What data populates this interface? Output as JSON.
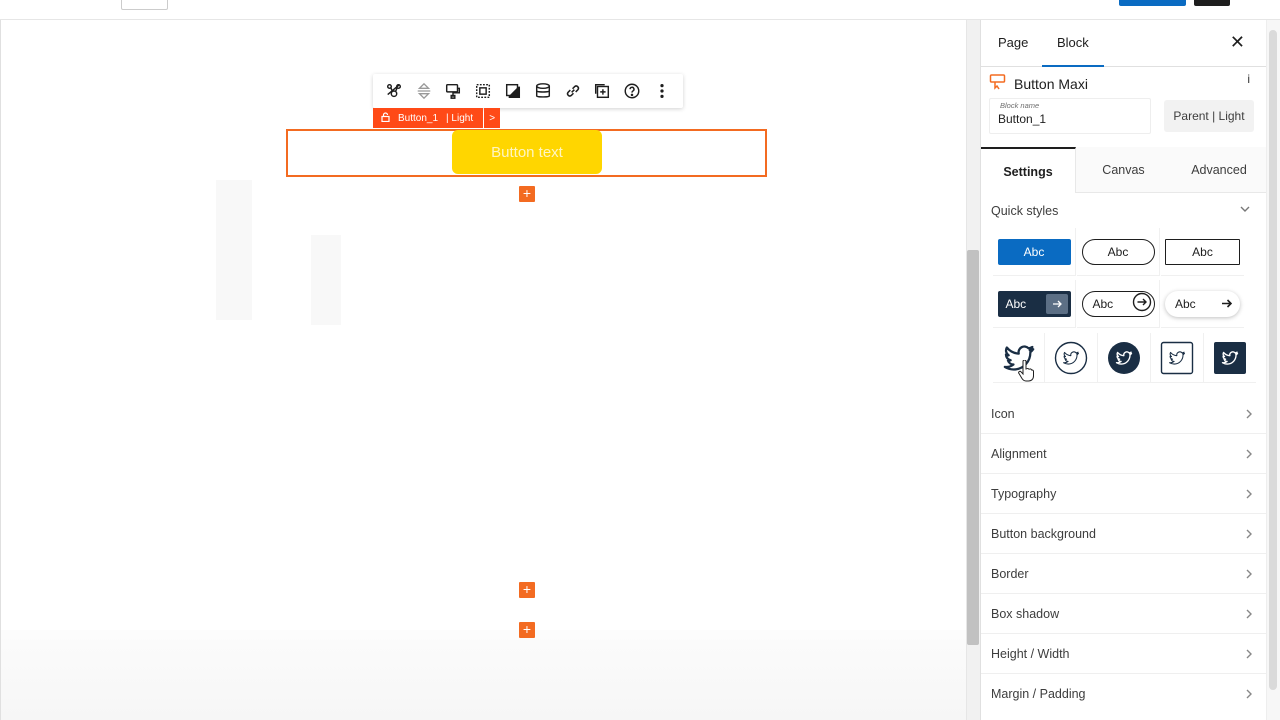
{
  "canvas": {
    "selected_block": {
      "label": "Button_1",
      "style": "| Light",
      "next_arrow": ">",
      "button_text": "Button text"
    },
    "toolbar_icons": [
      "style-cards-icon",
      "alignment-icon",
      "paint-format-icon",
      "padding-icon",
      "shadow-icon",
      "database-icon",
      "link-icon",
      "copy-add-icon",
      "help-icon",
      "more-options-icon"
    ],
    "add_symbol": "+"
  },
  "sidebar": {
    "tabs": [
      "Page",
      "Block"
    ],
    "active_tab": "Block",
    "close_symbol": "✕",
    "block_title": "Button Maxi",
    "info_symbol": "i",
    "block_name": {
      "label": "Block name",
      "value": "Button_1"
    },
    "parent_button": "Parent | Light",
    "inner_tabs": [
      "Settings",
      "Canvas",
      "Advanced"
    ],
    "active_inner_tab": "Settings",
    "quick_styles": {
      "title": "Quick styles",
      "text_presets": [
        {
          "label": "Abc",
          "variant": "filled-blue"
        },
        {
          "label": "Abc",
          "variant": "outline-pill"
        },
        {
          "label": "Abc",
          "variant": "outline-square"
        },
        {
          "label": "Abc",
          "variant": "dark-arrow"
        },
        {
          "label": "Abc",
          "variant": "outline-circle-arrow"
        },
        {
          "label": "Abc",
          "variant": "shadow-arrow"
        }
      ],
      "icon_presets": [
        {
          "icon": "twitter-icon",
          "variant": "plain"
        },
        {
          "icon": "twitter-icon",
          "variant": "circle-outline"
        },
        {
          "icon": "twitter-icon",
          "variant": "circle-filled"
        },
        {
          "icon": "twitter-icon",
          "variant": "square-outline"
        },
        {
          "icon": "twitter-icon",
          "variant": "square-filled"
        }
      ]
    },
    "sections": [
      "Icon",
      "Alignment",
      "Typography",
      "Button background",
      "Border",
      "Box shadow",
      "Height / Width",
      "Margin / Padding"
    ]
  },
  "colors": {
    "accent_orange": "#f36b21",
    "button_yellow": "#ffd600",
    "brand_blue": "#0a6bc2",
    "dark_navy": "#1a2e44"
  }
}
